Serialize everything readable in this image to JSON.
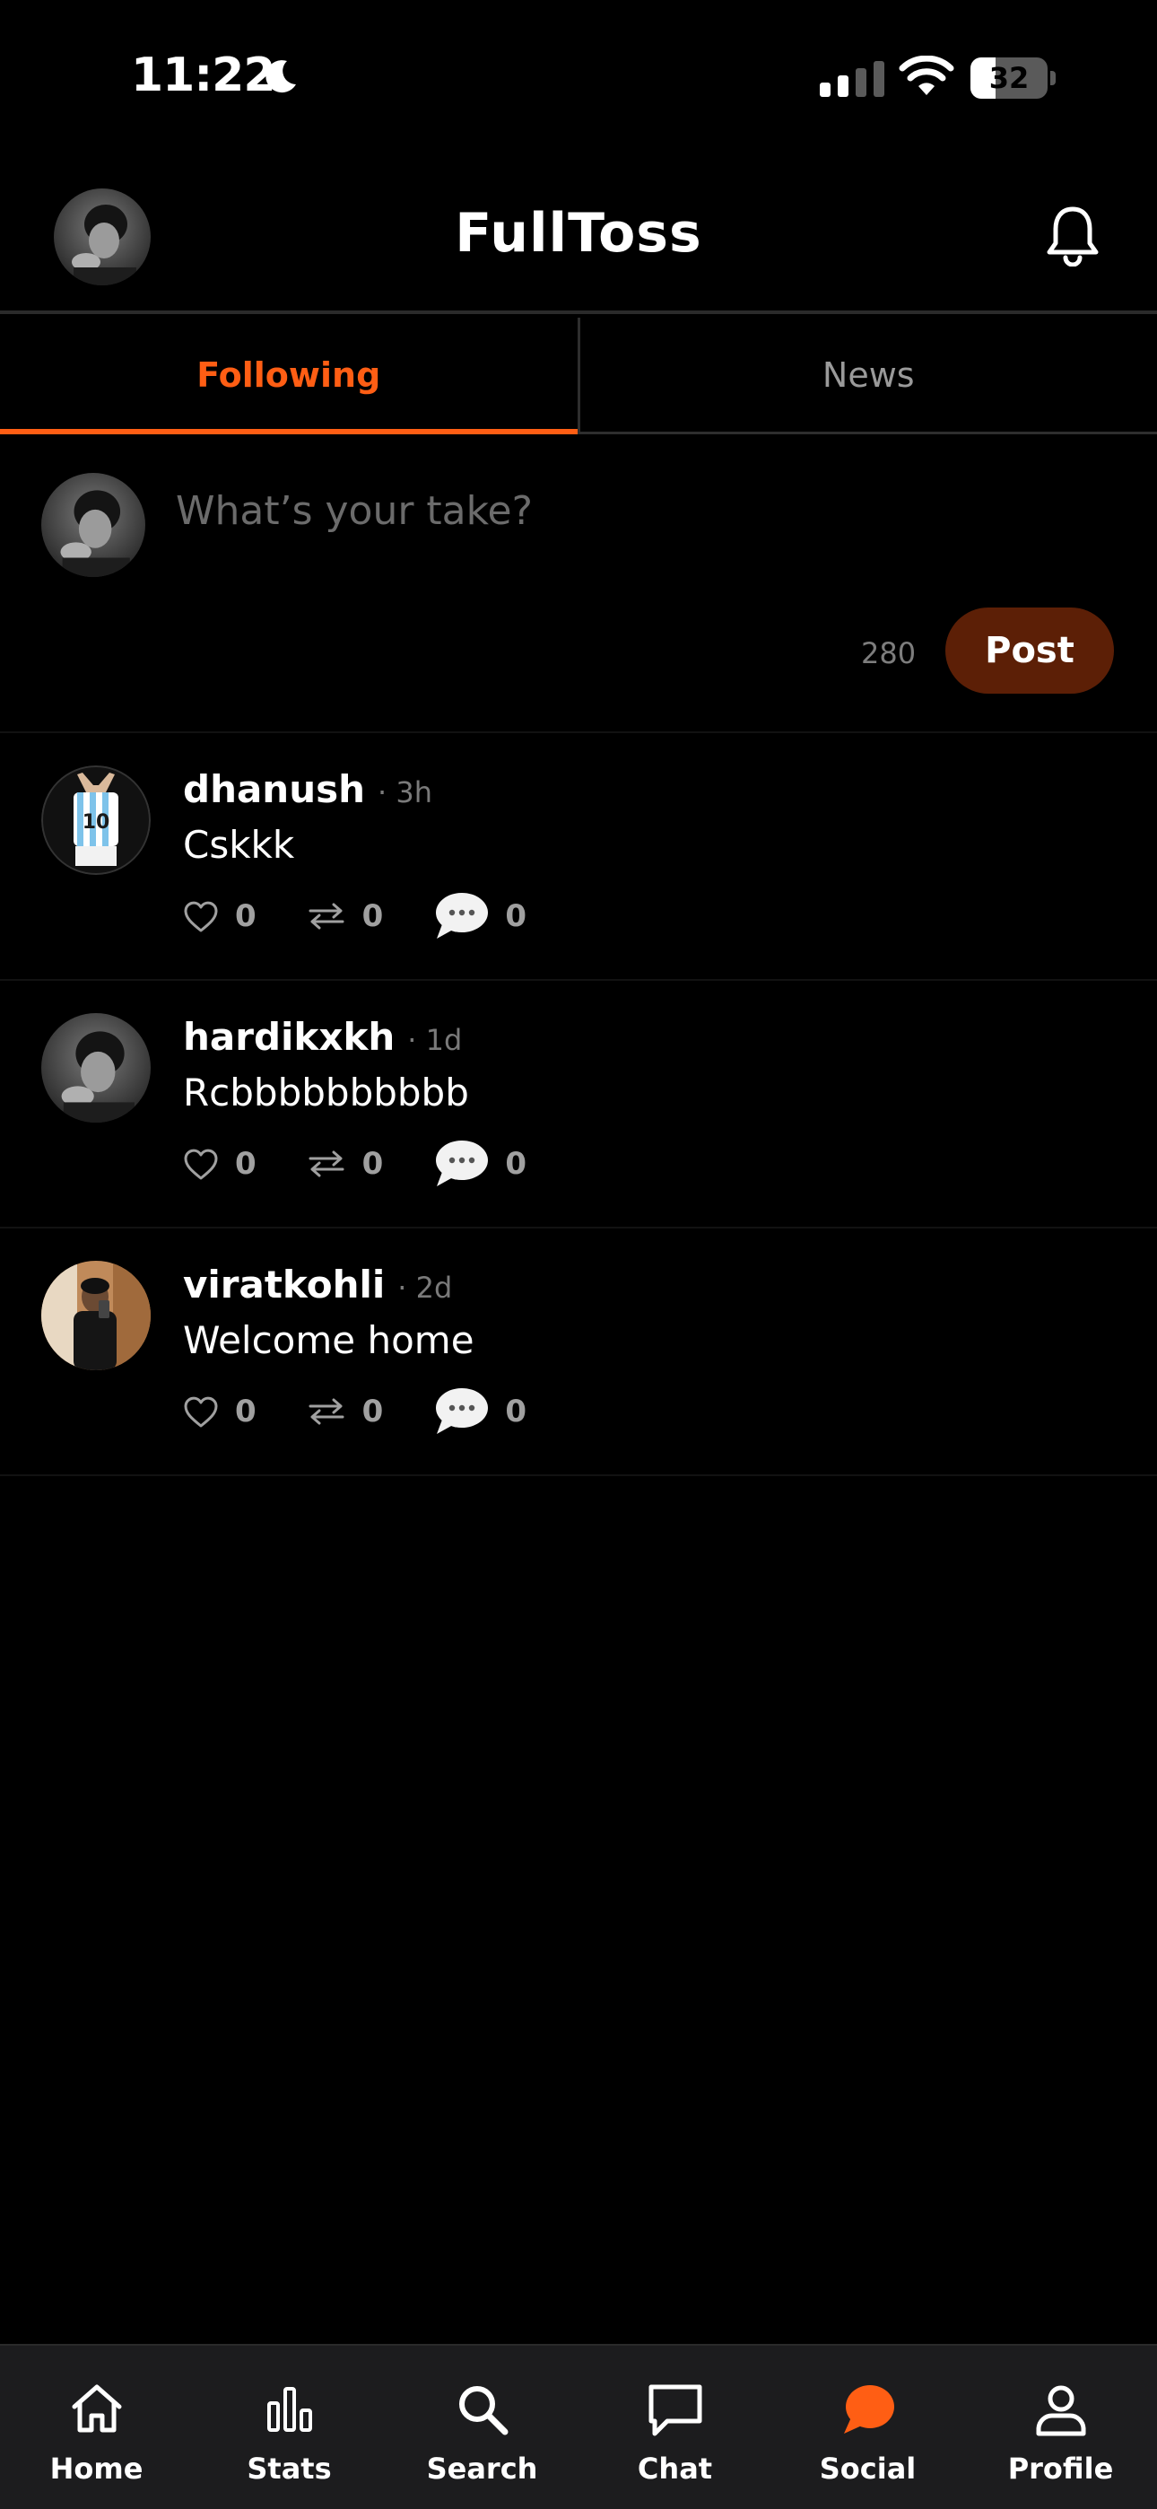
{
  "status_bar": {
    "time": "11:22",
    "battery_percent": "32",
    "battery_level": 0.32
  },
  "header": {
    "title": "FullToss"
  },
  "tabs": [
    {
      "label": "Following",
      "active": true
    },
    {
      "label": "News",
      "active": false
    }
  ],
  "composer": {
    "placeholder": "What’s your take?",
    "char_count": "280",
    "post_label": "Post"
  },
  "posts": [
    {
      "username": "dhanush",
      "time": "· 3h",
      "text": "Cskkk",
      "likes": "0",
      "reposts": "0",
      "comments": "0"
    },
    {
      "username": "hardikxkh",
      "time": "· 1d",
      "text": "Rcbbbbbbbbbb",
      "likes": "0",
      "reposts": "0",
      "comments": "0"
    },
    {
      "username": "viratkohli",
      "time": "· 2d",
      "text": "Welcome home",
      "likes": "0",
      "reposts": "0",
      "comments": "0"
    }
  ],
  "bottom_nav": [
    {
      "label": "Home",
      "icon": "home-icon",
      "active": false
    },
    {
      "label": "Stats",
      "icon": "bar-chart-icon",
      "active": false
    },
    {
      "label": "Search",
      "icon": "search-icon",
      "active": false
    },
    {
      "label": "Chat",
      "icon": "chat-icon",
      "active": false
    },
    {
      "label": "Social",
      "icon": "social-bubble-icon",
      "active": true
    },
    {
      "label": "Profile",
      "icon": "person-icon",
      "active": false
    }
  ],
  "colors": {
    "accent": "#ff5e14",
    "post_button": "#5c1f06",
    "background": "#000000",
    "nav_background": "#1c1c1e"
  }
}
